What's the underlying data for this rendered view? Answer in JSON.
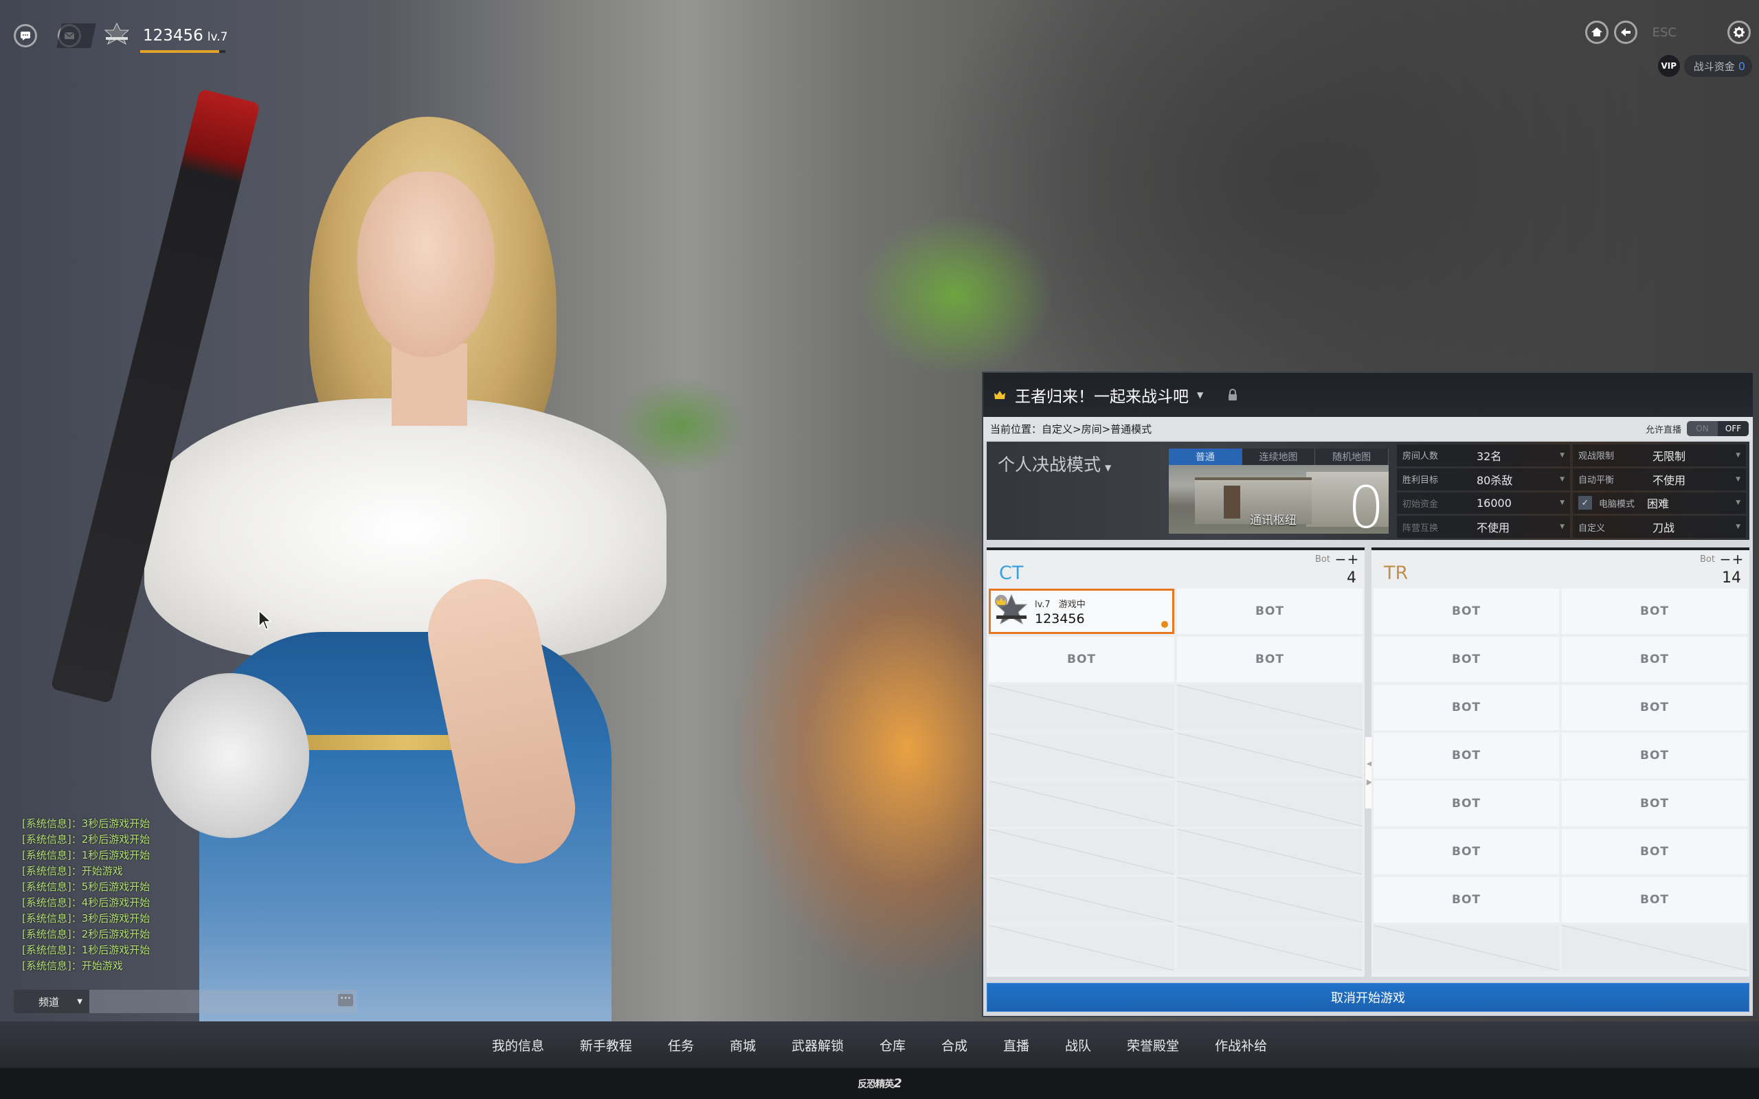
{
  "hud": {
    "user_name": "123456",
    "user_level": "lv.7",
    "xp_progress": 0.93,
    "esc_label": "ESC",
    "vip_label": "VIP",
    "funds_label": "战斗资金",
    "funds_value": "0",
    "icons": [
      "chat-icon",
      "mail-icon",
      "rank-emblem-icon",
      "home-icon",
      "back-arrow-icon",
      "gear-icon"
    ]
  },
  "chat": {
    "messages": [
      "[系统信息]：3秒后游戏开始",
      "[系统信息]：2秒后游戏开始",
      "[系统信息]：1秒后游戏开始",
      "[系统信息]：开始游戏",
      "[系统信息]：5秒后游戏开始",
      "[系统信息]：4秒后游戏开始",
      "[系统信息]：3秒后游戏开始",
      "[系统信息]：2秒后游戏开始",
      "[系统信息]：1秒后游戏开始",
      "[系统信息]：开始游戏"
    ],
    "channel": "频道",
    "input_value": ""
  },
  "room": {
    "title": "王者归来！一起来战斗吧",
    "breadcrumb": "当前位置：自定义>房间>普通模式",
    "stream_label": "允许直播",
    "stream_on": "ON",
    "stream_off": "OFF",
    "stream_state": "OFF",
    "mode": "个人决战模式",
    "map_tabs": [
      {
        "label": "普通",
        "active": true
      },
      {
        "label": "连续地图",
        "active": false
      },
      {
        "label": "随机地图",
        "active": false
      }
    ],
    "map_name": "通讯枢纽",
    "round_count": "0",
    "options": [
      {
        "label": "房间人数",
        "value": "32名",
        "enabled": true
      },
      {
        "label": "观战限制",
        "value": "无限制",
        "enabled": true
      },
      {
        "label": "胜利目标",
        "value": "80杀敌",
        "enabled": true
      },
      {
        "label": "自动平衡",
        "value": "不使用",
        "enabled": true
      },
      {
        "label": "初始资金",
        "value": "16000",
        "enabled": false
      },
      {
        "label": "电脑模式",
        "value": "困难",
        "enabled": true,
        "checked": true
      },
      {
        "label": "阵营互换",
        "value": "不使用",
        "enabled": false
      },
      {
        "label": "自定义",
        "value": "刀战",
        "enabled": true
      }
    ],
    "bot_label": "Bot",
    "teams": {
      "ct": {
        "name": "CT",
        "bot_count": "4",
        "player": {
          "level": "lv.7",
          "status": "游戏中",
          "name": "123456"
        },
        "bot_slots": 3,
        "empty_slots": 12
      },
      "tr": {
        "name": "TR",
        "bot_count": "14",
        "bot_slots": 14,
        "empty_slots": 2
      }
    },
    "bot_slot_label": "BOT",
    "cancel_label": "取消开始游戏"
  },
  "nav": {
    "items": [
      "我的信息",
      "新手教程",
      "任务",
      "商城",
      "武器解锁",
      "仓库",
      "合成",
      "直播",
      "战队",
      "荣誉殿堂",
      "作战补给"
    ]
  },
  "footer": {
    "logo_text": "反恐精英",
    "logo_num": "2"
  }
}
